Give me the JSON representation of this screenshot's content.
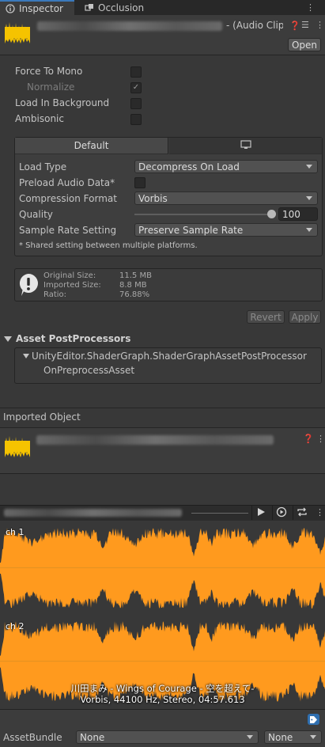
{
  "tabs": [
    {
      "label": "Inspector",
      "active": true
    },
    {
      "label": "Occlusion",
      "active": false
    }
  ],
  "header": {
    "type_suffix": "- (Audio Clip",
    "open_label": "Open"
  },
  "options": {
    "force_to_mono": "Force To Mono",
    "normalize": "Normalize",
    "load_in_background": "Load In Background",
    "ambisonic": "Ambisonic"
  },
  "platform_tabs": {
    "default_label": "Default",
    "standalone_icon": "monitor-icon"
  },
  "settings": {
    "load_type_label": "Load Type",
    "load_type_value": "Decompress On Load",
    "preload_label": "Preload Audio Data*",
    "compression_label": "Compression Format",
    "compression_value": "Vorbis",
    "quality_label": "Quality",
    "quality_value": "100",
    "quality_fraction": 1.0,
    "sample_rate_label": "Sample Rate Setting",
    "sample_rate_value": "Preserve Sample Rate",
    "note": "* Shared setting between multiple platforms."
  },
  "stats": {
    "original_label": "Original Size:",
    "original_value": "11.5 MB",
    "imported_label": "Imported Size:",
    "imported_value": "8.8 MB",
    "ratio_label": "Ratio:",
    "ratio_value": "76.88%"
  },
  "actions": {
    "revert_label": "Revert",
    "apply_label": "Apply"
  },
  "postprocessors": {
    "title": "Asset PostProcessors",
    "class_name": "UnityEditor.ShaderGraph.ShaderGraphAssetPostProcessor",
    "method": "OnPreprocessAsset"
  },
  "imported_object": {
    "title": "Imported Object"
  },
  "preview": {
    "ch1_label": "ch 1",
    "ch2_label": "ch 2",
    "track_title": "川田まみ - Wings of Courage - 空を超えて-",
    "track_info": "Vorbis, 44100 Hz, Stereo, 04:57.613"
  },
  "assetbundle": {
    "label": "AssetBundle",
    "name_value": "None",
    "variant_value": "None"
  },
  "colors": {
    "accent_blue": "#3a79bb",
    "waveform_orange": "#ff9a1e",
    "icon_yellow": "#f5c300"
  }
}
